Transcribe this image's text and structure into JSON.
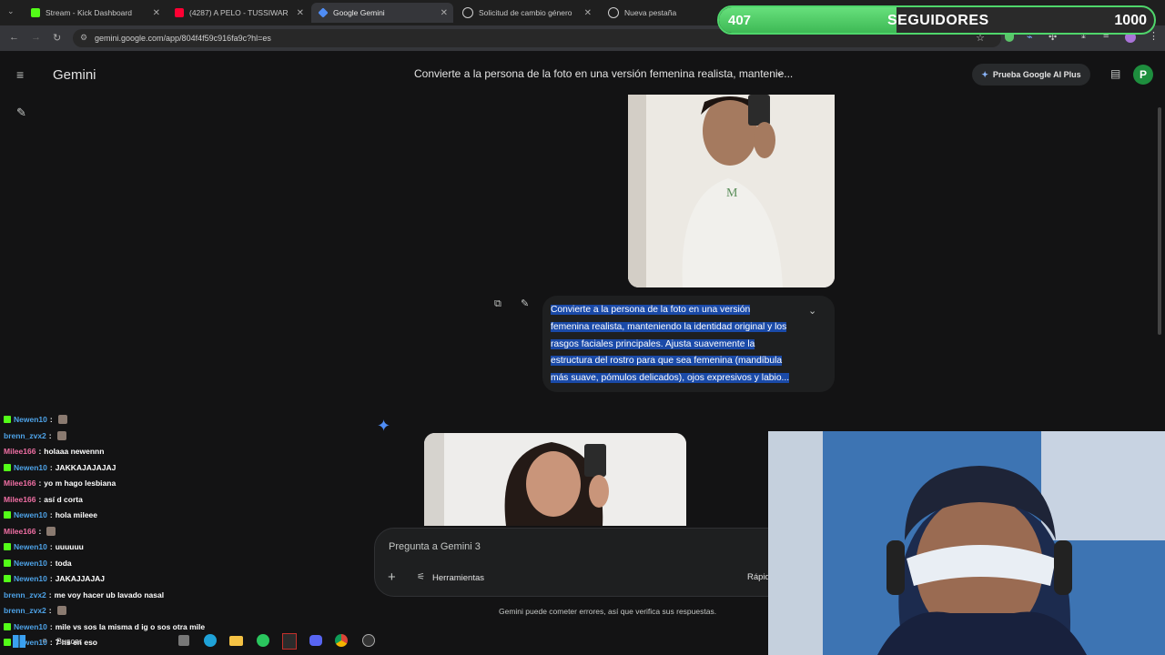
{
  "browser": {
    "tabs": [
      {
        "label": "Stream - Kick Dashboard",
        "icon": "kick-icon",
        "color": "#53fc18"
      },
      {
        "label": "(4287) A PELO - TUSSIWAR",
        "icon": "youtube-icon",
        "color": "#ff0033"
      },
      {
        "label": "Google Gemini",
        "icon": "gemini-icon",
        "color": "#4f8df5"
      },
      {
        "label": "Solicitud de cambio género",
        "icon": "chatgpt-icon",
        "color": "#cfcfcf"
      },
      {
        "label": "Nueva pestaña",
        "icon": "chrome-icon",
        "color": "#cfcfcf"
      }
    ],
    "url": "gemini.google.com/app/804f4f59c916fa9c?hl=es"
  },
  "followers": {
    "current": "407",
    "label": "SEGUIDORES",
    "goal": "1000",
    "progress": 0.407,
    "color": "#4fd66b"
  },
  "gemini": {
    "app_name": "Gemini",
    "chat_title": "Convierte a la persona de la foto en una versión femenina realista, manteniе...",
    "plus_button": "Prueba Google AI Plus",
    "avatar_letter": "P",
    "prompt_lines": [
      "Convierte a la persona de la foto en una versión",
      "femenina realista, manteniendo la identidad original y los",
      "rasgos faciales principales. Ajusta suavemente la",
      "estructura del rostro para que sea femenina (mandíbula",
      "más suave, pómulos delicados), ojos expresivos y labio..."
    ],
    "input_placeholder": "Pregunta a Gemini 3",
    "tools_label": "Herramientas",
    "mode_label": "Rápid",
    "disclaimer": "Gemini puede cometer errores, así que verifica sus respuestas."
  },
  "chat": [
    {
      "user": "Newen10",
      "msg": "",
      "color": "#4ea3e8",
      "badge": true
    },
    {
      "user": "brenn_zvx2",
      "msg": "",
      "color": "#4ea3e8",
      "badge": false
    },
    {
      "user": "Milee166",
      "msg": "holaaa newennn",
      "color": "#f06fa4",
      "badge": false
    },
    {
      "user": "Newen10",
      "msg": "JAKKAJAJAJAJ",
      "color": "#4ea3e8",
      "badge": true
    },
    {
      "user": "Milee166",
      "msg": "yo m hago lesbiana",
      "color": "#f06fa4",
      "badge": false
    },
    {
      "user": "Milee166",
      "msg": "así d corta",
      "color": "#f06fa4",
      "badge": false
    },
    {
      "user": "Newen10",
      "msg": "hola mileee",
      "color": "#4ea3e8",
      "badge": true
    },
    {
      "user": "Milee166",
      "msg": "",
      "color": "#f06fa4",
      "badge": false
    },
    {
      "user": "Newen10",
      "msg": "uuuuuu",
      "color": "#4ea3e8",
      "badge": true
    },
    {
      "user": "Newen10",
      "msg": "toda",
      "color": "#4ea3e8",
      "badge": true
    },
    {
      "user": "Newen10",
      "msg": "JAKAJJAJAJ",
      "color": "#4ea3e8",
      "badge": true
    },
    {
      "user": "brenn_zvx2",
      "msg": "me voy hacer ub lavado nasal",
      "color": "#4ea3e8",
      "badge": false
    },
    {
      "user": "brenn_zvx2",
      "msg": "",
      "color": "#4ea3e8",
      "badge": false
    },
    {
      "user": "Newen10",
      "msg": "mile vs sos la misma d ig o sos otra mile",
      "color": "#4ea3e8",
      "badge": true
    },
    {
      "user": "Newen10",
      "msg": "7 hs en eso",
      "color": "#4ea3e8",
      "badge": true
    }
  ],
  "taskbar": {
    "search_label": "Buscar"
  }
}
